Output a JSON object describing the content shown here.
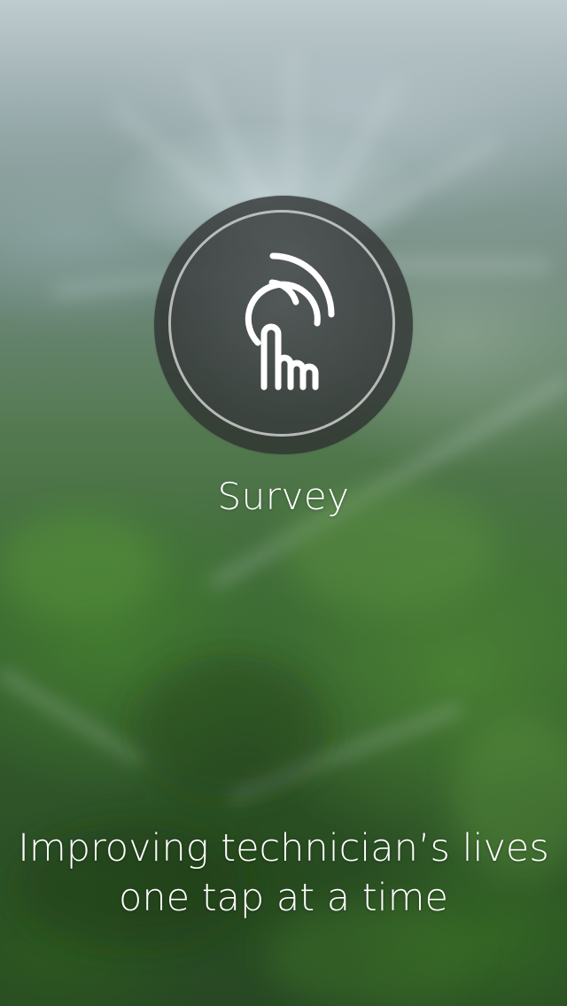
{
  "app": {
    "icon": "tap-finger-icon",
    "feature_label": "Survey"
  },
  "tagline": {
    "line1": "Improving technician’s lives",
    "line2": "one tap at a time"
  },
  "colors": {
    "text": "#ffffff",
    "button_fill": "#2d3030",
    "ring": "#d7d7d7",
    "background_green": "#3f6e37"
  }
}
